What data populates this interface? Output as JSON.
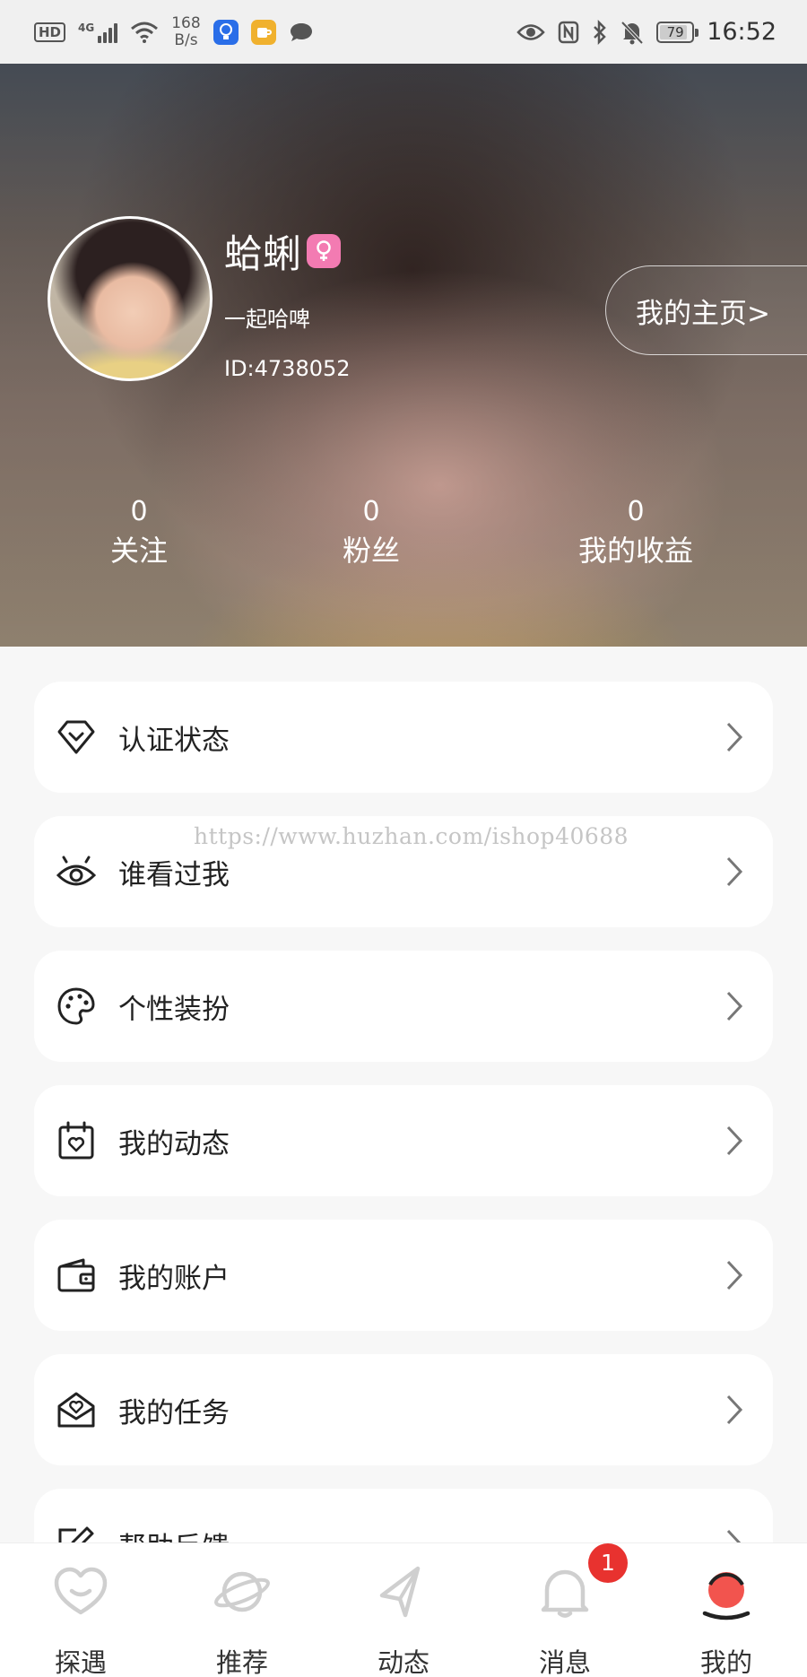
{
  "status_bar": {
    "hd": "HD",
    "network": "4G",
    "speed_value": "168",
    "speed_unit": "B/s",
    "battery": "79",
    "time": "16:52"
  },
  "profile": {
    "name": "蛤蜊",
    "signature": "一起哈啤",
    "id_text": "ID:4738052",
    "homepage_button": "我的主页>",
    "gender_color": "#f37bb2"
  },
  "stats": [
    {
      "value": "0",
      "label": "关注"
    },
    {
      "value": "0",
      "label": "粉丝"
    },
    {
      "value": "0",
      "label": "我的收益"
    }
  ],
  "menu": [
    {
      "label": "认证状态",
      "icon": "diamond-icon"
    },
    {
      "label": "谁看过我",
      "icon": "eye-icon"
    },
    {
      "label": "个性装扮",
      "icon": "palette-icon"
    },
    {
      "label": "我的动态",
      "icon": "calendar-heart-icon"
    },
    {
      "label": "我的账户",
      "icon": "wallet-icon"
    },
    {
      "label": "我的任务",
      "icon": "mail-heart-icon"
    },
    {
      "label": "帮助反馈",
      "icon": "edit-icon"
    }
  ],
  "watermark": "https://www.huzhan.com/ishop40688",
  "bottom_nav": [
    {
      "label": "探遇",
      "icon": "heart-icon",
      "active": false
    },
    {
      "label": "推荐",
      "icon": "planet-icon",
      "active": false
    },
    {
      "label": "动态",
      "icon": "paper-plane-icon",
      "active": false
    },
    {
      "label": "消息",
      "icon": "bell-icon",
      "active": false,
      "badge": "1"
    },
    {
      "label": "我的",
      "icon": "profile-icon",
      "active": true
    }
  ],
  "colors": {
    "accent": "#f2544e",
    "badge": "#e8322f",
    "icon_gray": "#cfcfcf"
  }
}
